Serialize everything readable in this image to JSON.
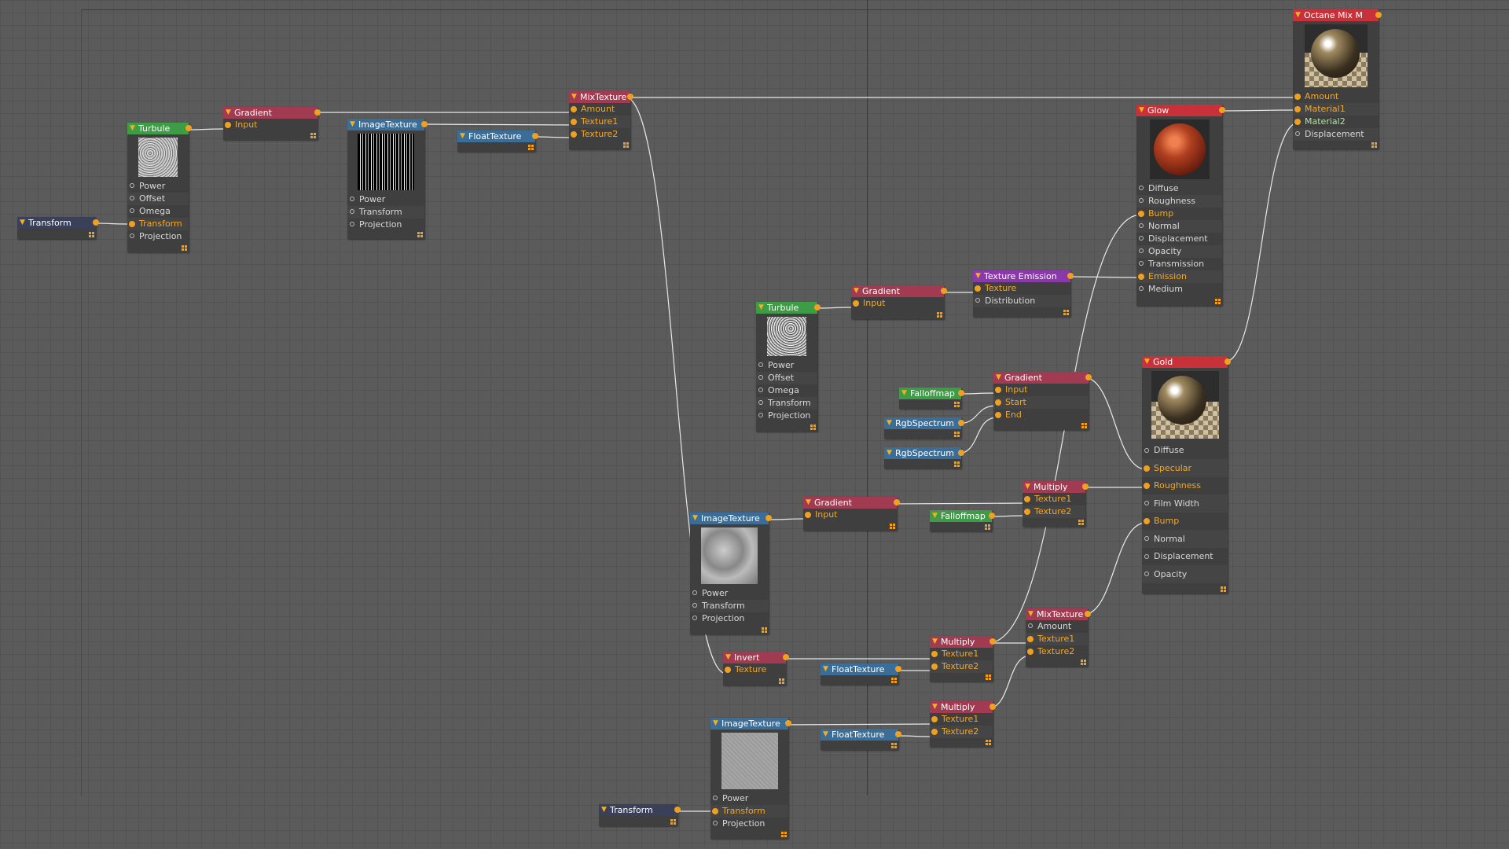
{
  "colors": {
    "background": "#5b5b5b",
    "grid": "#535353",
    "wire": "#e8e8e8",
    "pin_active": "#f0a020",
    "header_material": "#c8313a",
    "header_gradient": "#a23a52",
    "header_image": "#3a6e98",
    "header_procedural": "#3e9b46",
    "header_emission": "#8a3aa8",
    "header_transform": "#394058"
  },
  "nodes": {
    "transform_1": {
      "title": "Transform"
    },
    "turbule_1": {
      "title": "Turbule",
      "ports": [
        "Power",
        "Offset",
        "Omega",
        "Transform",
        "Projection"
      ]
    },
    "gradient_1": {
      "title": "Gradient",
      "ports": [
        "Input"
      ]
    },
    "imagetexture_1": {
      "title": "ImageTexture",
      "ports": [
        "Power",
        "Transform",
        "Projection"
      ]
    },
    "floattexture_1": {
      "title": "FloatTexture"
    },
    "mixtexture_1": {
      "title": "MixTexture",
      "ports": [
        "Amount",
        "Texture1",
        "Texture2"
      ]
    },
    "octane_mix": {
      "title": "Octane Mix M",
      "ports": [
        "Amount",
        "Material1",
        "Material2",
        "Displacement"
      ]
    },
    "glow": {
      "title": "Glow",
      "ports": [
        "Diffuse",
        "Roughness",
        "Bump",
        "Normal",
        "Displacement",
        "Opacity",
        "Transmission",
        "Emission",
        "Medium"
      ]
    },
    "texture_emission": {
      "title": "Texture Emission",
      "ports": [
        "Texture",
        "Distribution"
      ]
    },
    "gradient_2": {
      "title": "Gradient",
      "ports": [
        "Input"
      ]
    },
    "turbule_2": {
      "title": "Turbule",
      "ports": [
        "Power",
        "Offset",
        "Omega",
        "Transform",
        "Projection"
      ]
    },
    "falloffmap_1": {
      "title": "Falloffmap"
    },
    "gradient_3": {
      "title": "Gradient",
      "ports": [
        "Input",
        "Start",
        "End"
      ]
    },
    "rgbspectrum_1": {
      "title": "RgbSpectrum"
    },
    "rgbspectrum_2": {
      "title": "RgbSpectrum"
    },
    "gold": {
      "title": "Gold",
      "ports": [
        "Diffuse",
        "Specular",
        "Roughness",
        "Film Width",
        "Bump",
        "Normal",
        "Displacement",
        "Opacity"
      ]
    },
    "multiply_1": {
      "title": "Multiply",
      "ports": [
        "Texture1",
        "Texture2"
      ]
    },
    "gradient_4": {
      "title": "Gradient",
      "ports": [
        "Input"
      ]
    },
    "falloffmap_2": {
      "title": "Falloffmap"
    },
    "imagetexture_2": {
      "title": "ImageTexture",
      "ports": [
        "Power",
        "Transform",
        "Projection"
      ]
    },
    "mixtexture_2": {
      "title": "MixTexture",
      "ports": [
        "Amount",
        "Texture1",
        "Texture2"
      ]
    },
    "invert": {
      "title": "Invert",
      "ports": [
        "Texture"
      ]
    },
    "floattexture_2": {
      "title": "FloatTexture"
    },
    "multiply_2": {
      "title": "Multiply",
      "ports": [
        "Texture1",
        "Texture2"
      ]
    },
    "multiply_3": {
      "title": "Multiply",
      "ports": [
        "Texture1",
        "Texture2"
      ]
    },
    "imagetexture_3": {
      "title": "ImageTexture",
      "ports": [
        "Power",
        "Transform",
        "Projection"
      ]
    },
    "floattexture_3": {
      "title": "FloatTexture"
    },
    "transform_2": {
      "title": "Transform"
    }
  }
}
